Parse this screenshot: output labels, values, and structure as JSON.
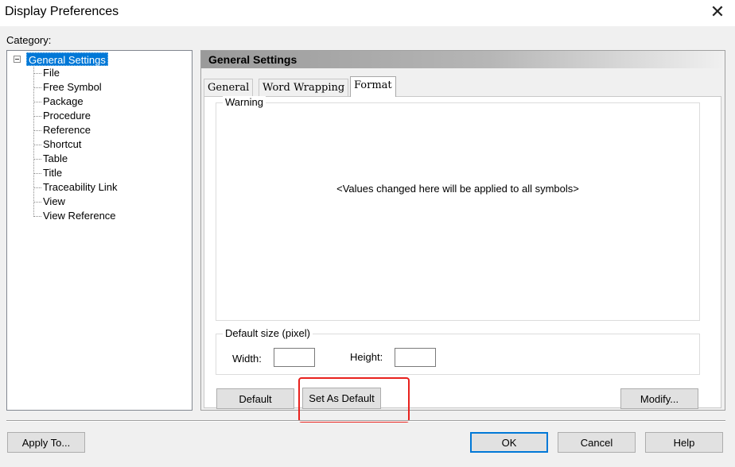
{
  "window": {
    "title": "Display Preferences",
    "close_glyph": "✕"
  },
  "category": {
    "label": "Category:",
    "root": "General Settings",
    "items": [
      "File",
      "Free Symbol",
      "Package",
      "Procedure",
      "Reference",
      "Shortcut",
      "Table",
      "Title",
      "Traceability Link",
      "View",
      "View Reference"
    ]
  },
  "panel": {
    "header": "General Settings",
    "tabs": [
      "General",
      "Word Wrapping",
      "Format"
    ],
    "active_tab": "Format",
    "warning_group": {
      "title": "Warning",
      "message": "<Values changed here will be applied to all symbols>"
    },
    "size_group": {
      "title": "Default size (pixel)",
      "width_label": "Width:",
      "width_value": "",
      "height_label": "Height:",
      "height_value": ""
    },
    "buttons": {
      "default": "Default",
      "set_as_default": "Set As Default",
      "modify": "Modify..."
    }
  },
  "footer": {
    "apply_to": "Apply To...",
    "ok": "OK",
    "cancel": "Cancel",
    "help": "Help"
  },
  "colors": {
    "selection": "#0078d7",
    "highlight_box": "#e8211d"
  }
}
